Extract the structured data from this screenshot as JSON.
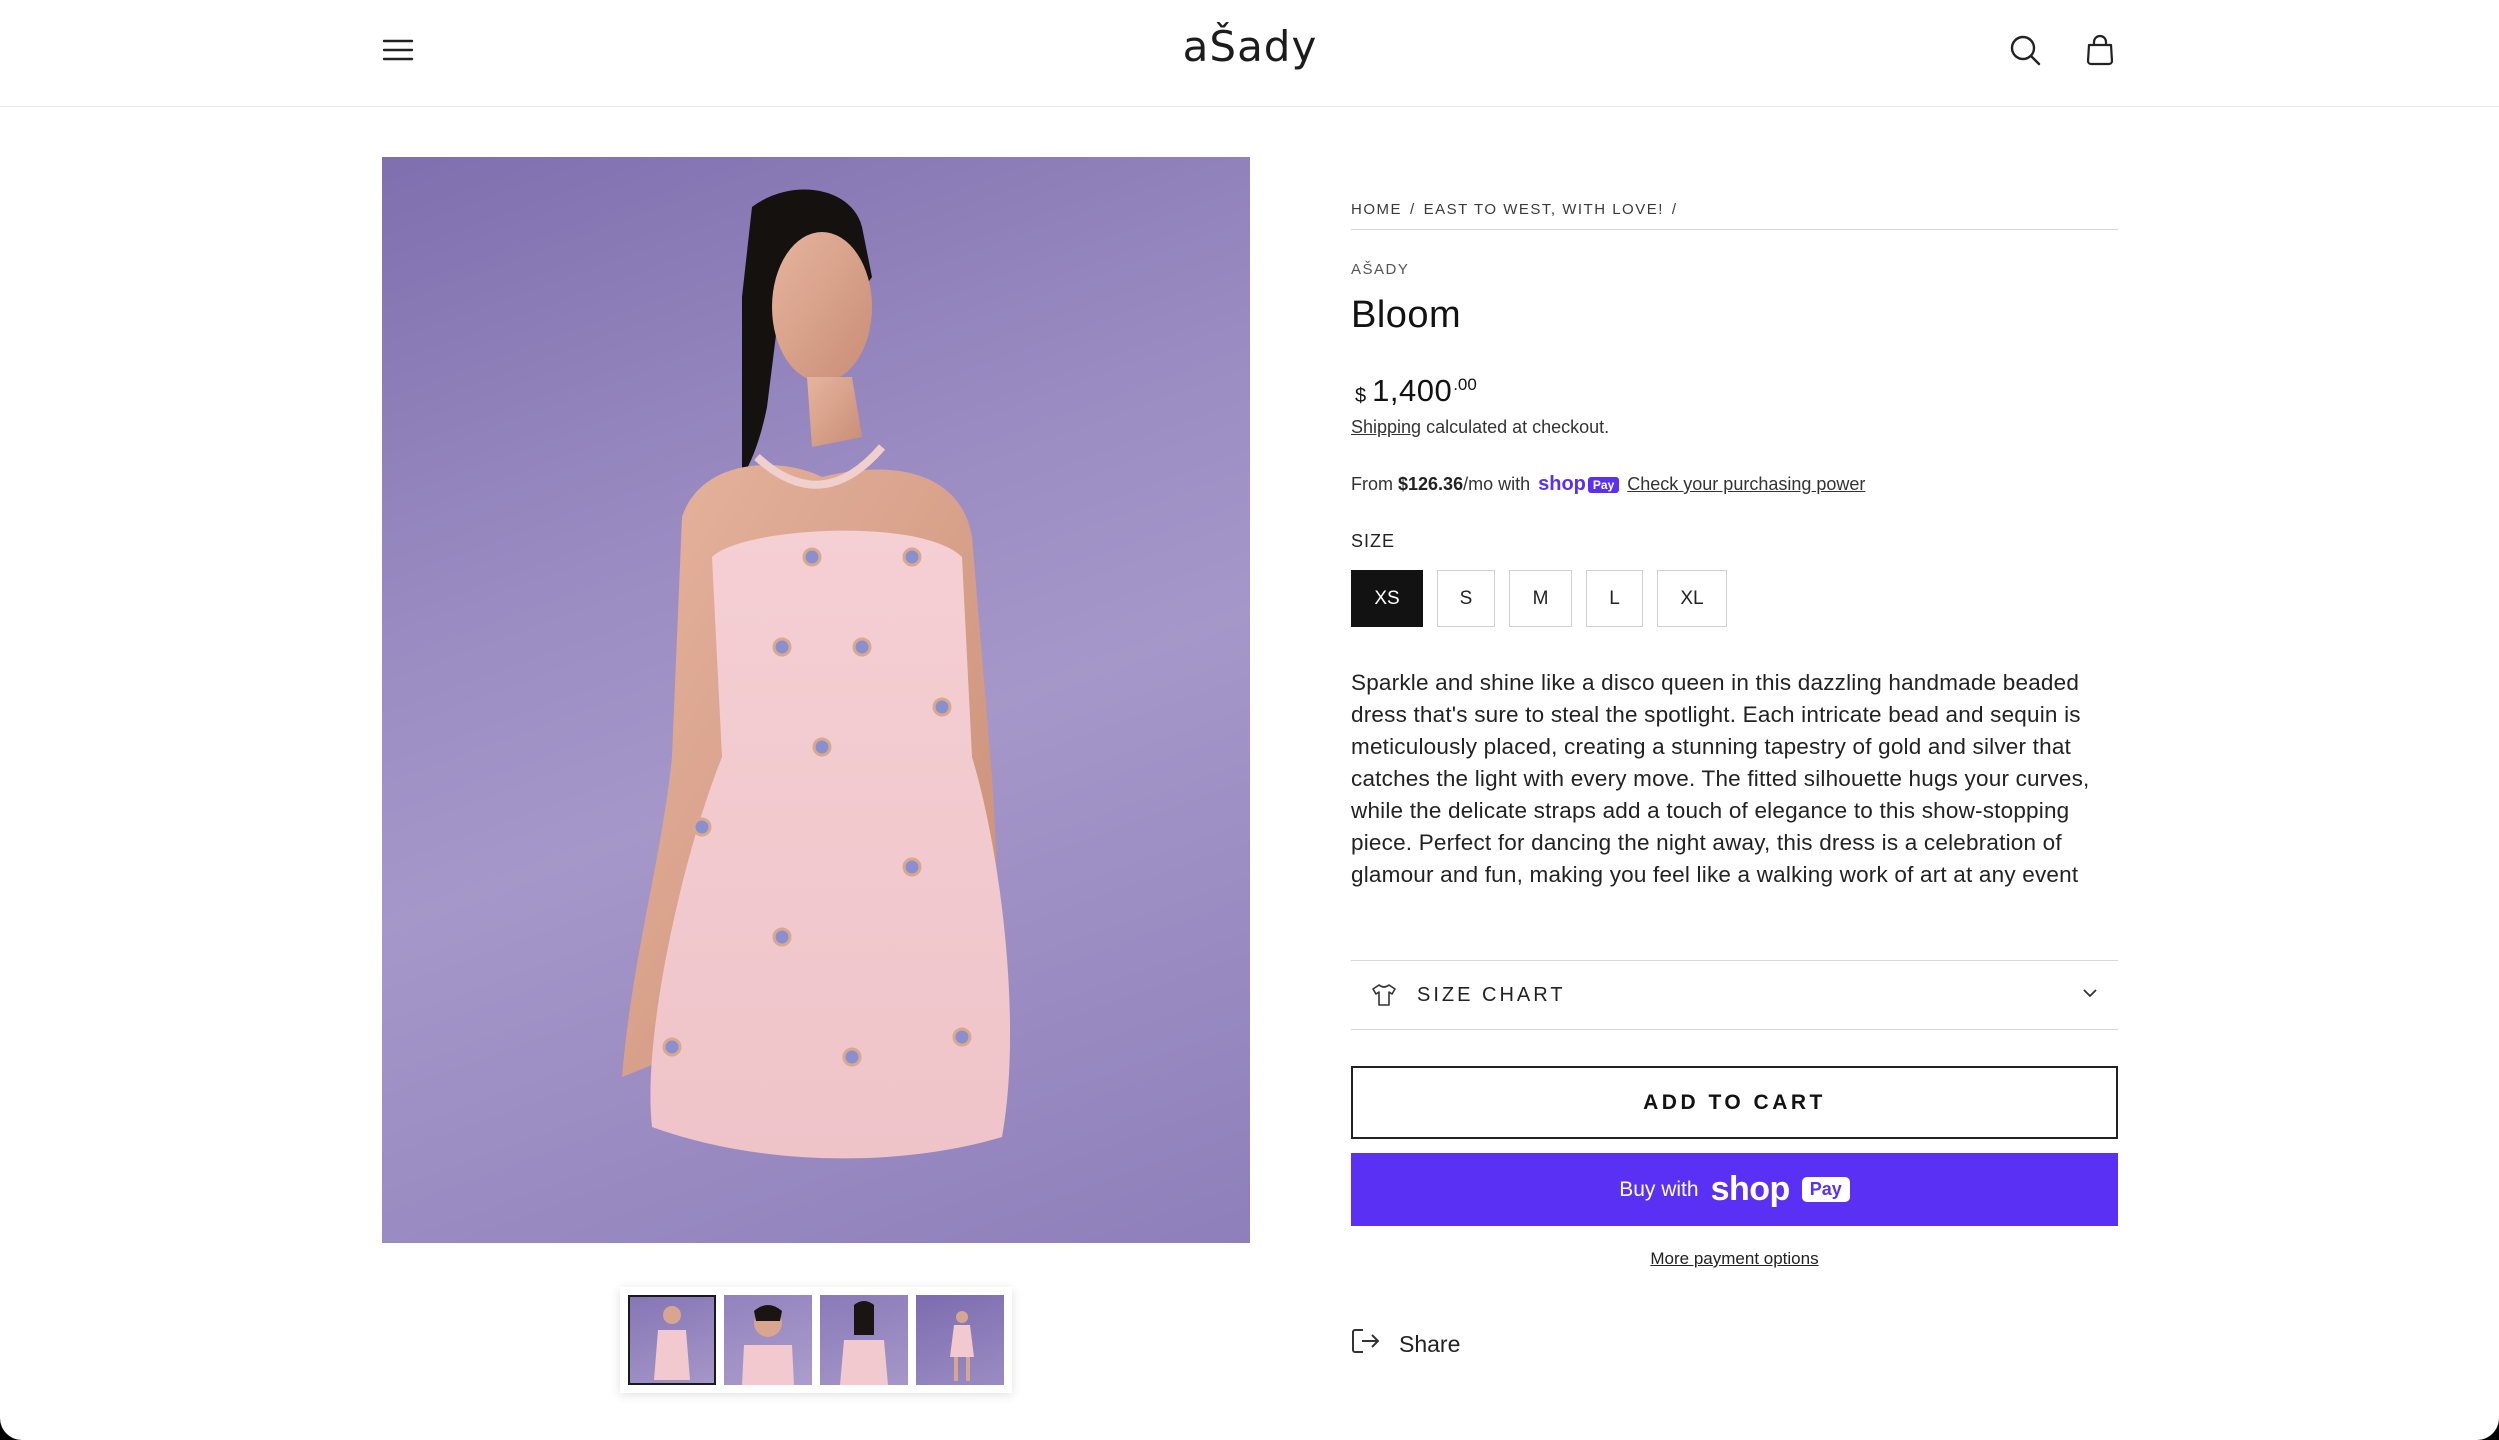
{
  "header": {
    "logo": "aŠady",
    "icons": [
      "menu-icon",
      "search-icon",
      "cart-icon"
    ]
  },
  "gallery": {
    "main_image_alt": "Model in pink strapless beaded mini dress on purple background",
    "thumbnails": [
      "thumb-1",
      "thumb-2",
      "thumb-3",
      "thumb-4"
    ],
    "active_thumbnail": 0
  },
  "product": {
    "breadcrumb": [
      "HOME",
      "/",
      "EAST TO WEST, WITH LOVE!",
      "/"
    ],
    "vendor": "AŠADY",
    "title": "Bloom",
    "price": {
      "currency": "$",
      "amount": "1,400",
      "cents": ".00"
    },
    "shipping": {
      "link": "Shipping",
      "text": " calculated at checkout."
    },
    "shoppay": {
      "prefix": "From",
      "amount": "$126.36",
      "suffix": "/mo with",
      "brand": "shop",
      "brand_pay": "Pay",
      "link": "Check your purchasing power"
    },
    "size_label": "SIZE",
    "sizes": [
      "XS",
      "S",
      "M",
      "L",
      "XL"
    ],
    "selected_size": "XS",
    "description": "Sparkle and shine like a disco queen in this dazzling handmade beaded dress that's sure to steal the spotlight. Each intricate bead and sequin is meticulously placed, creating a stunning tapestry of gold and silver that catches the light with every move. The fitted silhouette hugs your curves, while the delicate straps add a touch of elegance to this show-stopping piece. Perfect for dancing the night away, this dress is a celebration of glamour and fun, making you feel like a walking work of art at any event",
    "size_chart_label": "SIZE CHART",
    "add_to_cart": "ADD TO CART",
    "buy_now": {
      "prefix": "Buy with",
      "brand": "shop",
      "brand_pay": "Pay"
    },
    "more_payment": "More payment options",
    "share": "Share"
  },
  "colors": {
    "accent": "#5a31f4",
    "dark": "#121212",
    "bg_image": "#9a8cc2"
  }
}
